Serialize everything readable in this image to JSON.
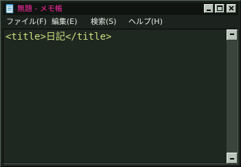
{
  "window": {
    "title": "無題 - メモ帳",
    "icons": {
      "app": "notepad-icon",
      "minimize": "minimize-icon",
      "maximize": "maximize-icon",
      "close": "close-icon",
      "scroll_up": "arrow-up-icon",
      "scroll_down": "arrow-down-icon"
    },
    "colors": {
      "background": "#1c231e",
      "title_text": "#ff2aa0",
      "editor_text": "#c8e17e",
      "menu_text": "#e8eee8"
    }
  },
  "menu": {
    "file": "ファイル(F)",
    "edit": "編集(E)",
    "search": "検索(S)",
    "help": "ヘルプ(H)"
  },
  "editor": {
    "content": "<title>日記</title>"
  }
}
